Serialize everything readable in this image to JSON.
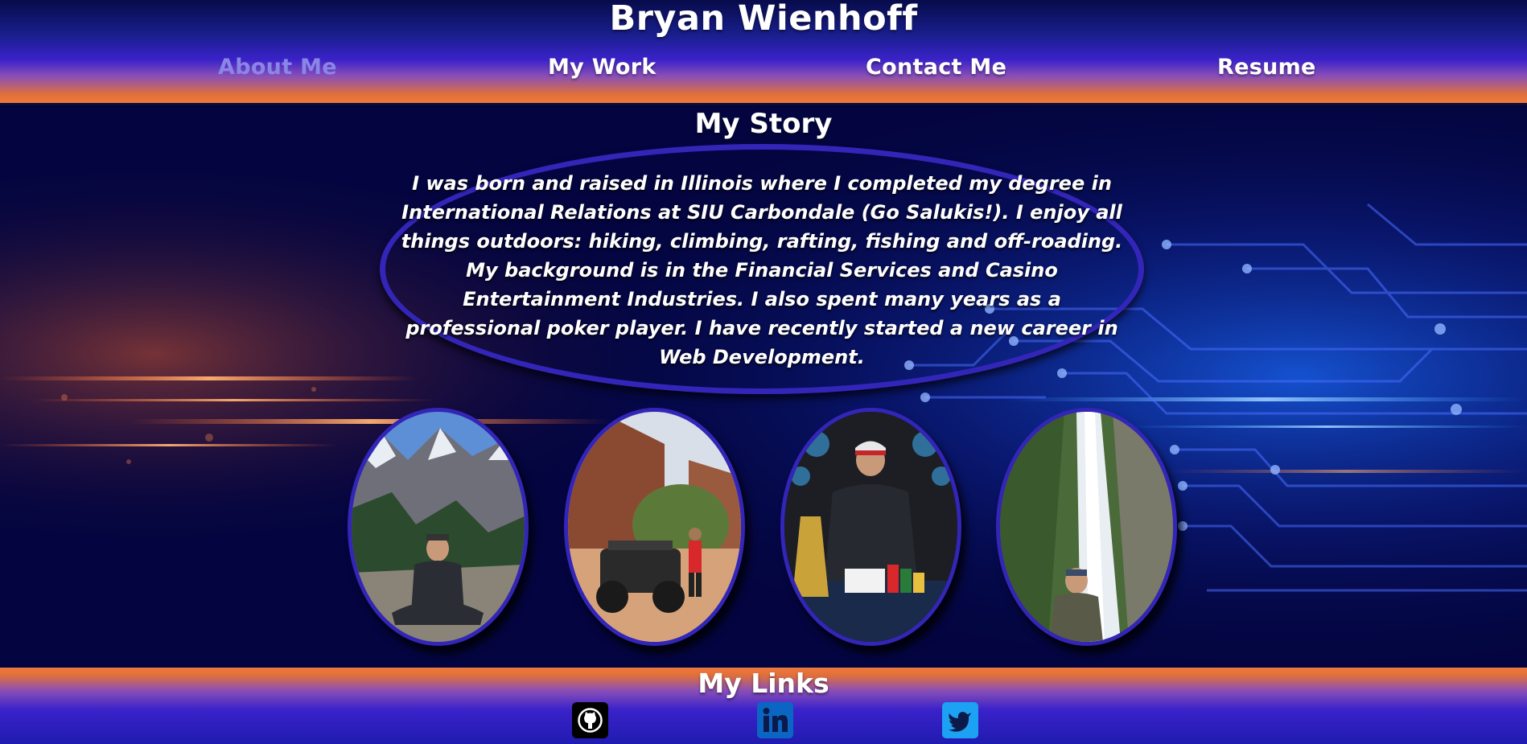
{
  "header": {
    "title": "Bryan Wienhoff",
    "nav": {
      "about": "About Me",
      "work": "My Work",
      "contact": "Contact Me",
      "resume": "Resume"
    }
  },
  "story": {
    "title": "My Story",
    "text": "I was born and raised in Illinois where I completed my degree in International Relations at SIU Carbondale (Go Salukis!).  I enjoy all things outdoors: hiking, climbing, rafting, fishing and off-roading.  My background is in the Financial Services and Casino Entertainment Industries. I also spent many years as a professional poker player.  I have recently started a  new career in Web Development."
  },
  "photos": [
    {
      "icon": "mountain-sitting-photo"
    },
    {
      "icon": "offroad-vehicle-photo"
    },
    {
      "icon": "poker-trophy-photo"
    },
    {
      "icon": "waterfall-photo"
    }
  ],
  "footer": {
    "title": "My Links",
    "links": [
      {
        "icon": "github-icon"
      },
      {
        "icon": "linkedin-icon"
      },
      {
        "icon": "twitter-icon"
      }
    ]
  },
  "colors": {
    "accent_purple": "#3325b8",
    "active_nav": "#8a86e6",
    "orange": "#ee7a3a",
    "navy": "#03043a"
  }
}
